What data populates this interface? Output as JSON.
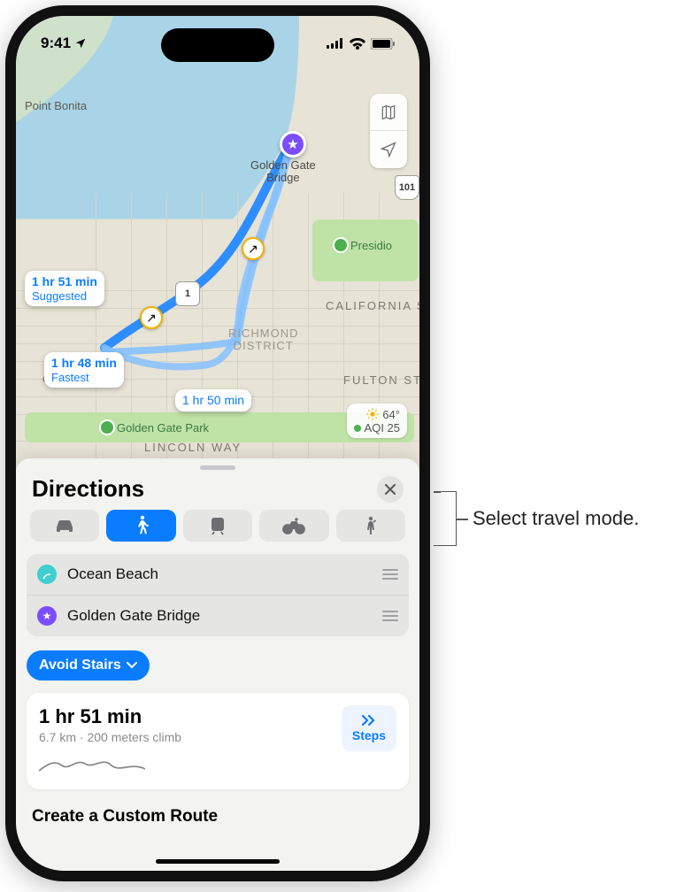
{
  "status": {
    "time": "9:41"
  },
  "map": {
    "destination_label": "Golden Gate\nBridge",
    "place_point_bonita": "Point Bonita",
    "road_california": "CALIFORNIA ST",
    "road_fulton": "FULTON ST",
    "road_lincoln": "LINCOLN WAY",
    "district_richmond": "RICHMOND\nDISTRICT",
    "poi_presidio": "Presidio",
    "poi_ggpark": "Golden Gate Park",
    "highway_1": "1",
    "highway_101": "101",
    "beach_label": "ch",
    "bubble1_time": "1 hr 51 min",
    "bubble1_sub": "Suggested",
    "bubble2_time": "1 hr 48 min",
    "bubble2_sub": "Fastest",
    "bubble3_time": "1 hr 50 min",
    "weather_temp": "64°",
    "weather_aqi": "AQI 25"
  },
  "sheet": {
    "title": "Directions",
    "start": "Ocean Beach",
    "end": "Golden Gate Bridge",
    "filter": "Avoid Stairs",
    "route_duration": "1 hr 51 min",
    "route_meta": "6.7 km · 200 meters climb",
    "steps_label": "Steps",
    "custom_route": "Create a Custom Route"
  },
  "callout": "Select travel mode."
}
